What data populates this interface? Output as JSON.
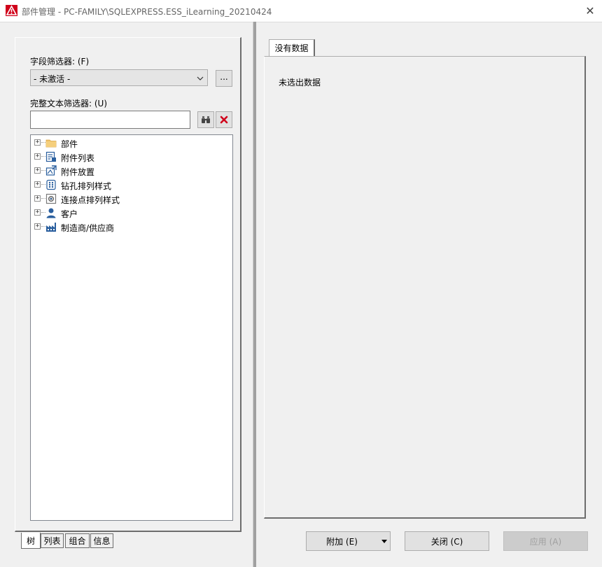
{
  "window": {
    "title": "部件管理 - PC-FAMILY\\SQLEXPRESS.ESS_iLearning_20210424",
    "close_glyph": "✕",
    "accent_color": "#d0021b"
  },
  "filters": {
    "field_filter_label": "字段筛选器: (F)",
    "field_filter_value": "- 未激活 -",
    "more_button_label": "...",
    "fulltext_filter_label": "完整文本筛选器: (U)",
    "fulltext_filter_value": "",
    "search_icon": "binoculars-icon",
    "clear_icon": "delete-icon"
  },
  "tree": {
    "items": [
      {
        "label": "部件",
        "icon": "folder-icon"
      },
      {
        "label": "附件列表",
        "icon": "accessory-list-icon"
      },
      {
        "label": "附件放置",
        "icon": "accessory-placement-icon"
      },
      {
        "label": "钻孔排列样式",
        "icon": "drill-pattern-icon"
      },
      {
        "label": "连接点排列样式",
        "icon": "connection-point-pattern-icon"
      },
      {
        "label": "客户",
        "icon": "customer-icon"
      },
      {
        "label": "制造商/供应商",
        "icon": "manufacturer-icon"
      }
    ]
  },
  "bottom_tabs": [
    {
      "label": "树",
      "active": true
    },
    {
      "label": "列表",
      "active": false
    },
    {
      "label": "组合",
      "active": false
    },
    {
      "label": "信息",
      "active": false
    }
  ],
  "right": {
    "tab_label": "没有数据",
    "message": "未选出数据"
  },
  "actions": {
    "add_label": "附加 (E)",
    "close_label": "关闭 (C)",
    "apply_label": "应用 (A)"
  }
}
